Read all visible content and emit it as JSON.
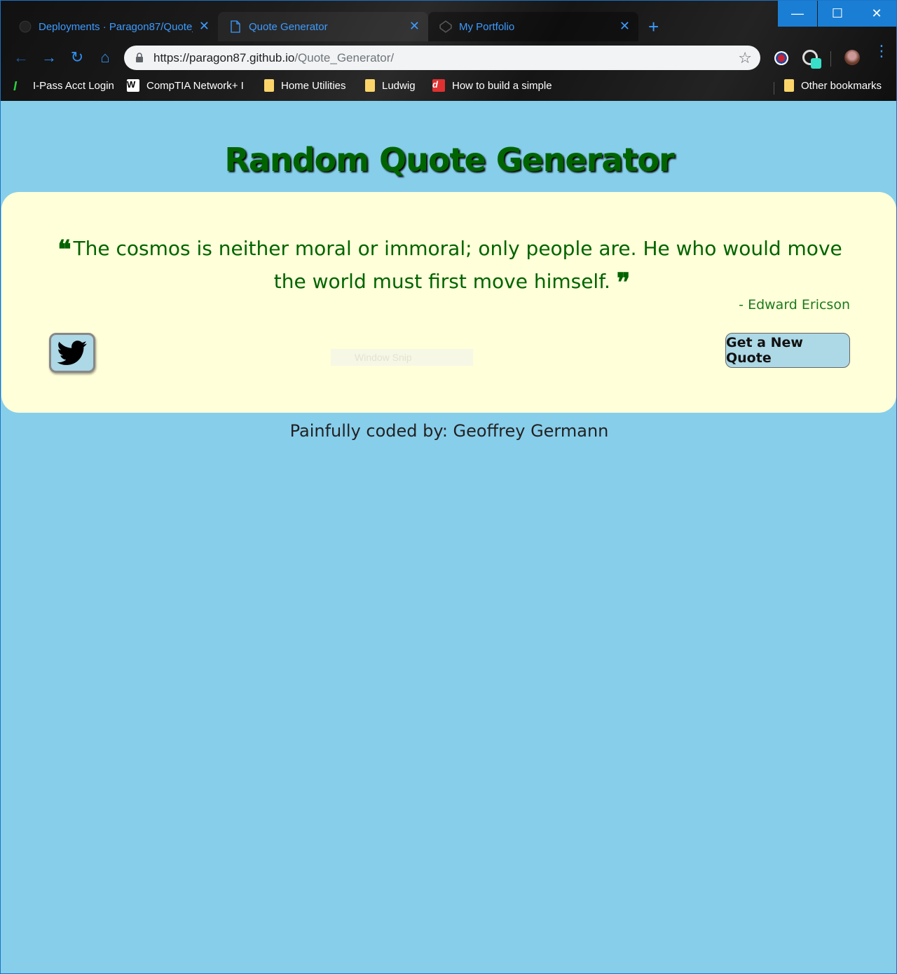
{
  "browser": {
    "tabs": [
      {
        "label": "Deployments · Paragon87/Quote_Generator",
        "close": "✕"
      },
      {
        "label": "Quote Generator",
        "close": "✕"
      },
      {
        "label": "My Portfolio",
        "close": "✕"
      }
    ],
    "new_tab": "+",
    "window_controls": {
      "minimize": "—",
      "maximize": "☐",
      "close": "✕"
    },
    "nav": {
      "back": "←",
      "forward": "→",
      "reload": "↻",
      "home": "⌂"
    },
    "address": {
      "url_main": "https://paragon87.github.io",
      "url_path": "/Quote_Generator/"
    },
    "bookmark_star": "☆",
    "menu": "⋮",
    "bookmarks": [
      {
        "label": "I-Pass Acct Login",
        "icon": "ipass-icon"
      },
      {
        "label": "CompTIA Network+ I",
        "icon": "wikipedia-icon"
      },
      {
        "label": "Home Utilities",
        "icon": "folder-icon"
      },
      {
        "label": "Ludwig",
        "icon": "folder-icon"
      },
      {
        "label": "How to build a simple",
        "icon": "dev-icon"
      }
    ],
    "other_bookmarks": "Other bookmarks"
  },
  "page": {
    "title": "Random Quote Generator",
    "quote": "The cosmos is neither moral or immoral; only people are. He who would move the world must first move himself.",
    "open_quote": "❝",
    "close_quote": "❞",
    "author": "- Edward Ericson",
    "new_quote_button": "Get a New Quote",
    "overlay_text": "Window Snip",
    "footer": "Painfully coded by: Geoffrey Germann"
  },
  "colors": {
    "background": "#87ceeb",
    "quote_box": "#ffffd9",
    "text_green": "#006400",
    "button_blue": "#add8e6",
    "browser_accent": "#3d9bff"
  }
}
